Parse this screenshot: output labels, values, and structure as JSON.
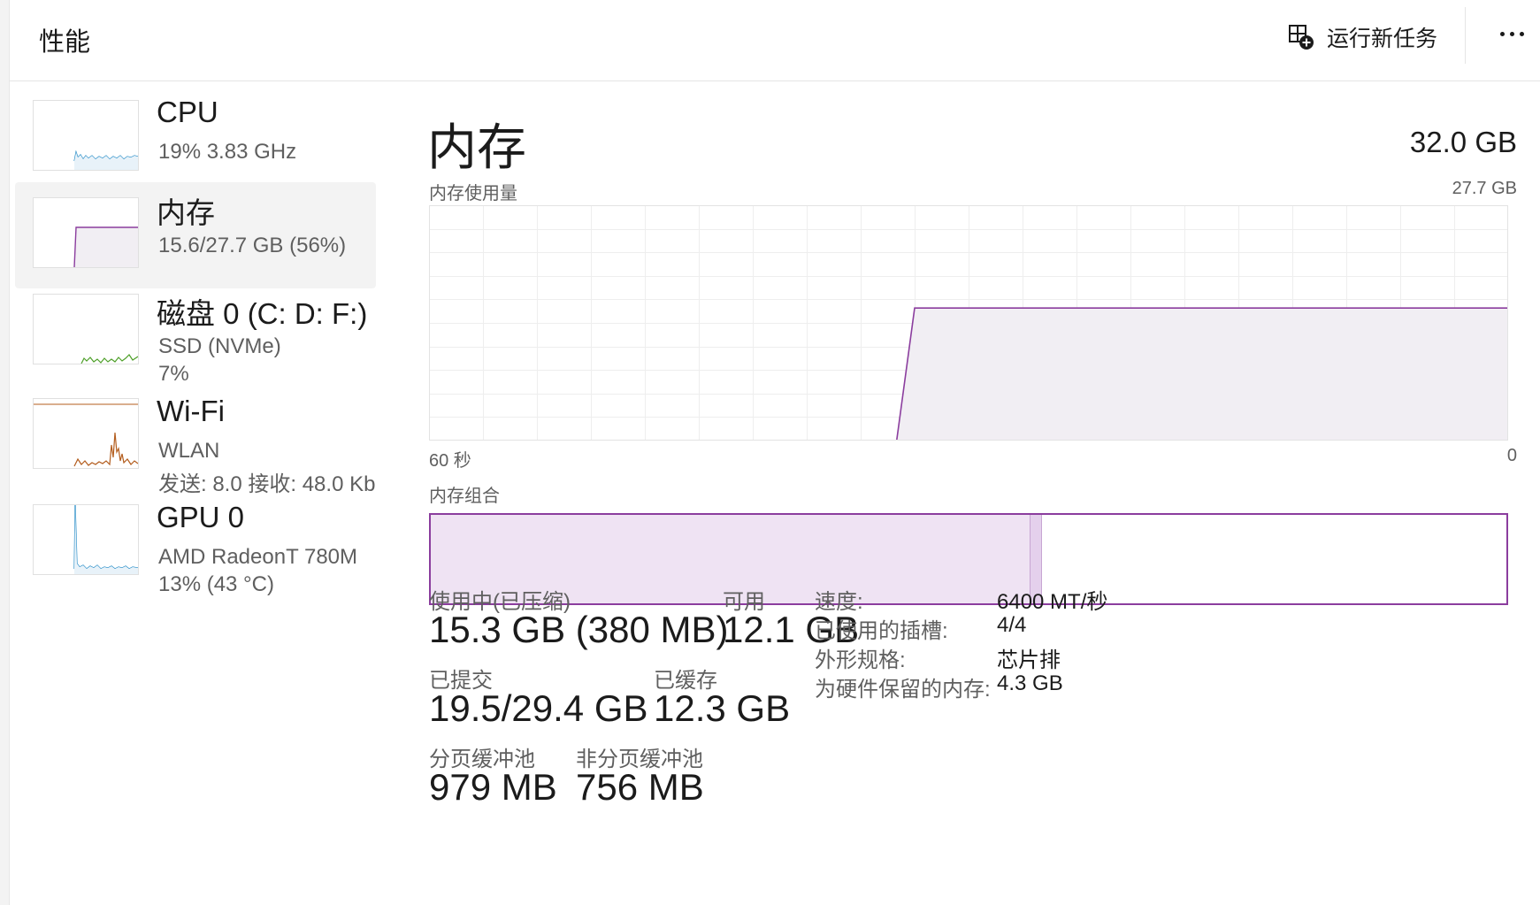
{
  "header": {
    "title": "性能",
    "run_task_label": "运行新任务",
    "run_task_icon": "run-new-task-icon",
    "more_icon": "more-icon"
  },
  "sidebar": {
    "items": [
      {
        "name": "CPU",
        "line1": "19%  3.83 GHz",
        "line2": "",
        "color": "#1a86c4",
        "selected": false
      },
      {
        "name": "内存",
        "line1": "15.6/27.7 GB (56%)",
        "line2": "",
        "color": "#8b3d9e",
        "selected": true
      },
      {
        "name": "磁盘 0 (C: D: F:)",
        "line1": "SSD (NVMe)",
        "line2": "7%",
        "color": "#4fa02a",
        "selected": false
      },
      {
        "name": "Wi-Fi",
        "line1": "WLAN",
        "line2": "发送: 8.0  接收: 48.0 Kb",
        "color": "#b35d1e",
        "selected": false
      },
      {
        "name": "GPU 0",
        "line1": "AMD RadeonT 780M",
        "line2": "13% (43 °C)",
        "color": "#1a86c4",
        "selected": false
      }
    ]
  },
  "memory": {
    "title": "内存",
    "total": "32.0 GB",
    "usage_label": "内存使用量",
    "usage_max": "27.7 GB",
    "axis_left": "60 秒",
    "axis_right": "0",
    "composition_label": "内存组合",
    "composition": {
      "in_use_fraction": 0.557,
      "modified_fraction": 0.011
    },
    "accent_color": "#8b3d9e",
    "fill_color": "#f1eef3",
    "stats": {
      "in_use_label": "使用中(已压缩)",
      "in_use_value": "15.3 GB (380 MB)",
      "available_label": "可用",
      "available_value": "12.1 GB",
      "committed_label": "已提交",
      "committed_value": "19.5/29.4 GB",
      "cached_label": "已缓存",
      "cached_value": "12.3 GB",
      "paged_label": "分页缓冲池",
      "paged_value": "979 MB",
      "nonpaged_label": "非分页缓冲池",
      "nonpaged_value": "756 MB"
    },
    "properties": {
      "speed_label": "速度:",
      "speed_value": "6400 MT/秒",
      "slots_label": "已使用的插槽:",
      "slots_value": "4/4",
      "form_label": "外形规格:",
      "form_value": "芯片排",
      "reserved_label": "为硬件保留的内存:",
      "reserved_value": "4.3 GB"
    }
  },
  "chart_data": {
    "type": "area",
    "xlabel": "",
    "ylabel": "",
    "x_range_label": [
      "60 秒",
      "0"
    ],
    "ylim": [
      0,
      27.7
    ],
    "x": [
      60,
      34,
      33,
      0
    ],
    "y": [
      0,
      0,
      15.6,
      15.6
    ]
  }
}
